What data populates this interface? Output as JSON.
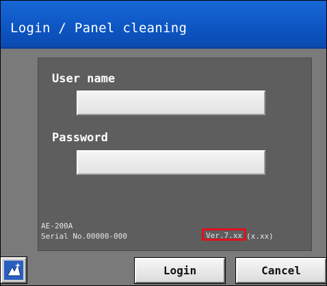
{
  "window": {
    "title": "Login / Panel cleaning"
  },
  "form": {
    "user_label": "User name",
    "user_value": "",
    "password_label": "Password",
    "password_value": ""
  },
  "device": {
    "model": "AE-200A",
    "serial": "Serial No.00000-000",
    "version": "Ver.7.xx",
    "version_detail": "(x.xx)"
  },
  "buttons": {
    "login": "Login",
    "cancel": "Cancel",
    "panel_icon": "sparkle-pointer-icon"
  },
  "colors": {
    "title_bar": "#0d55c2",
    "highlight": "#e0101c"
  }
}
